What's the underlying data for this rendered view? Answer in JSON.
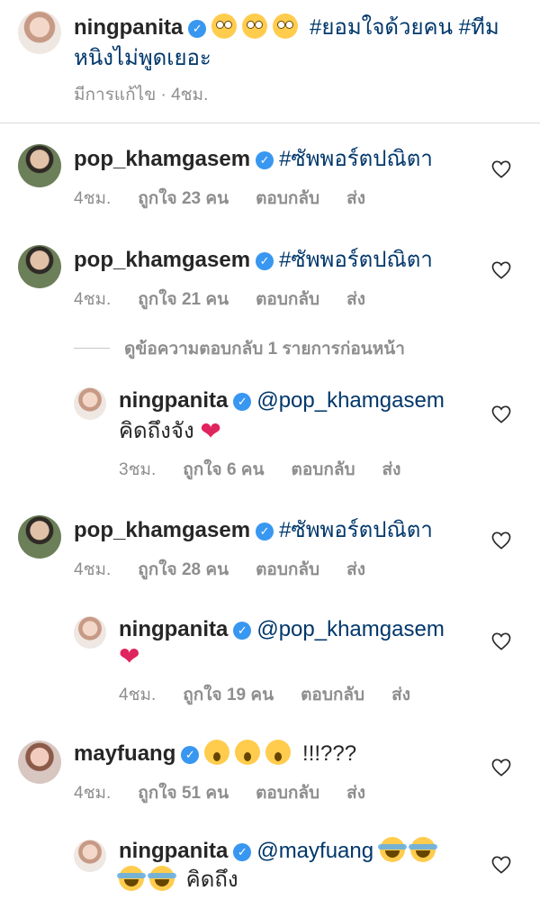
{
  "caption": {
    "username": "ningpanita",
    "emoji": [
      "face-with-rolling-eyes",
      "face-with-rolling-eyes",
      "face-with-rolling-eyes"
    ],
    "hashtag1": "#ยอมใจด้วยคน",
    "hashtag2": "#ทีม",
    "line2": "หนิงไม่พูดเยอะ",
    "edited": "มีการแก้ไข",
    "time": "4ชม."
  },
  "labels": {
    "reply": "ตอบกลับ",
    "send": "ส่ง",
    "view_previous": "ดูข้อความตอบกลับ 1 รายการก่อนหน้า"
  },
  "comments": [
    {
      "username": "pop_khamgasem",
      "text": "#ซัพพอร์ตปณิตา",
      "time": "4ชม.",
      "likes": "ถูกใจ 23 คน"
    },
    {
      "username": "pop_khamgasem",
      "text": "#ซัพพอร์ตปณิตา",
      "time": "4ชม.",
      "likes": "ถูกใจ 21 คน",
      "reply": {
        "username": "ningpanita",
        "mention": "@pop_khamgasem",
        "line2": "คิดถึงจัง",
        "time": "3ชม.",
        "likes": "ถูกใจ 6 คน"
      }
    },
    {
      "username": "pop_khamgasem",
      "text": "#ซัพพอร์ตปณิตา",
      "time": "4ชม.",
      "likes": "ถูกใจ 28 คน",
      "reply": {
        "username": "ningpanita",
        "mention": "@pop_khamgasem",
        "time": "4ชม.",
        "likes": "ถูกใจ 19 คน"
      }
    },
    {
      "username": "mayfuang",
      "emoji": [
        "face-with-open-mouth",
        "face-with-open-mouth",
        "face-with-open-mouth"
      ],
      "text": "!!!???",
      "time": "4ชม.",
      "likes": "ถูกใจ 51 คน",
      "reply": {
        "username": "ningpanita",
        "mention": "@mayfuang",
        "line2": "คิดถึง"
      }
    }
  ],
  "colors": {
    "hashtag": "#00376b",
    "verified": "#3897f0",
    "meta": "#8e8e8e",
    "heart": "#e0245e"
  }
}
